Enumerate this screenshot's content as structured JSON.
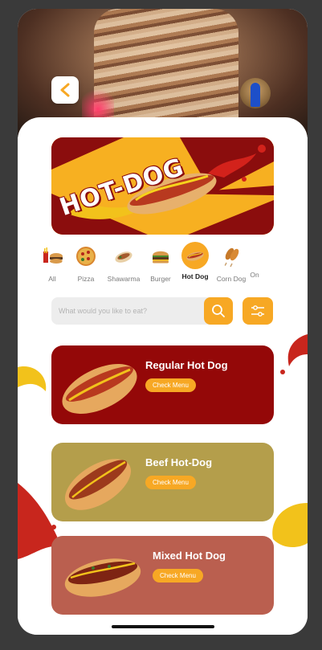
{
  "back_label": "Back",
  "banner": {
    "title": "HOT-DOG"
  },
  "categories": [
    {
      "label": "All",
      "icon": "burger-fries-icon",
      "active": false
    },
    {
      "label": "Pizza",
      "icon": "pizza-icon",
      "active": false
    },
    {
      "label": "Shawarma",
      "icon": "shawarma-icon",
      "active": false
    },
    {
      "label": "Burger",
      "icon": "burger-icon",
      "active": false
    },
    {
      "label": "Hot Dog",
      "icon": "hotdog-icon",
      "active": true
    },
    {
      "label": "Corn Dog",
      "icon": "corndog-icon",
      "active": false
    },
    {
      "label": "On",
      "icon": "",
      "active": false
    }
  ],
  "search": {
    "placeholder": "What would you like to eat?"
  },
  "items": [
    {
      "title": "Regular Hot Dog",
      "button": "Check Menu",
      "color": "#940808"
    },
    {
      "title": "Beef Hot-Dog",
      "button": "Check Menu",
      "color": "#b49e4b"
    },
    {
      "title": "Mixed Hot Dog",
      "button": "Check Menu",
      "color": "#ba5f4f"
    }
  ],
  "colors": {
    "accent": "#f7a824",
    "banner_red": "#8b0d0d",
    "banner_yellow": "#f7b021"
  }
}
